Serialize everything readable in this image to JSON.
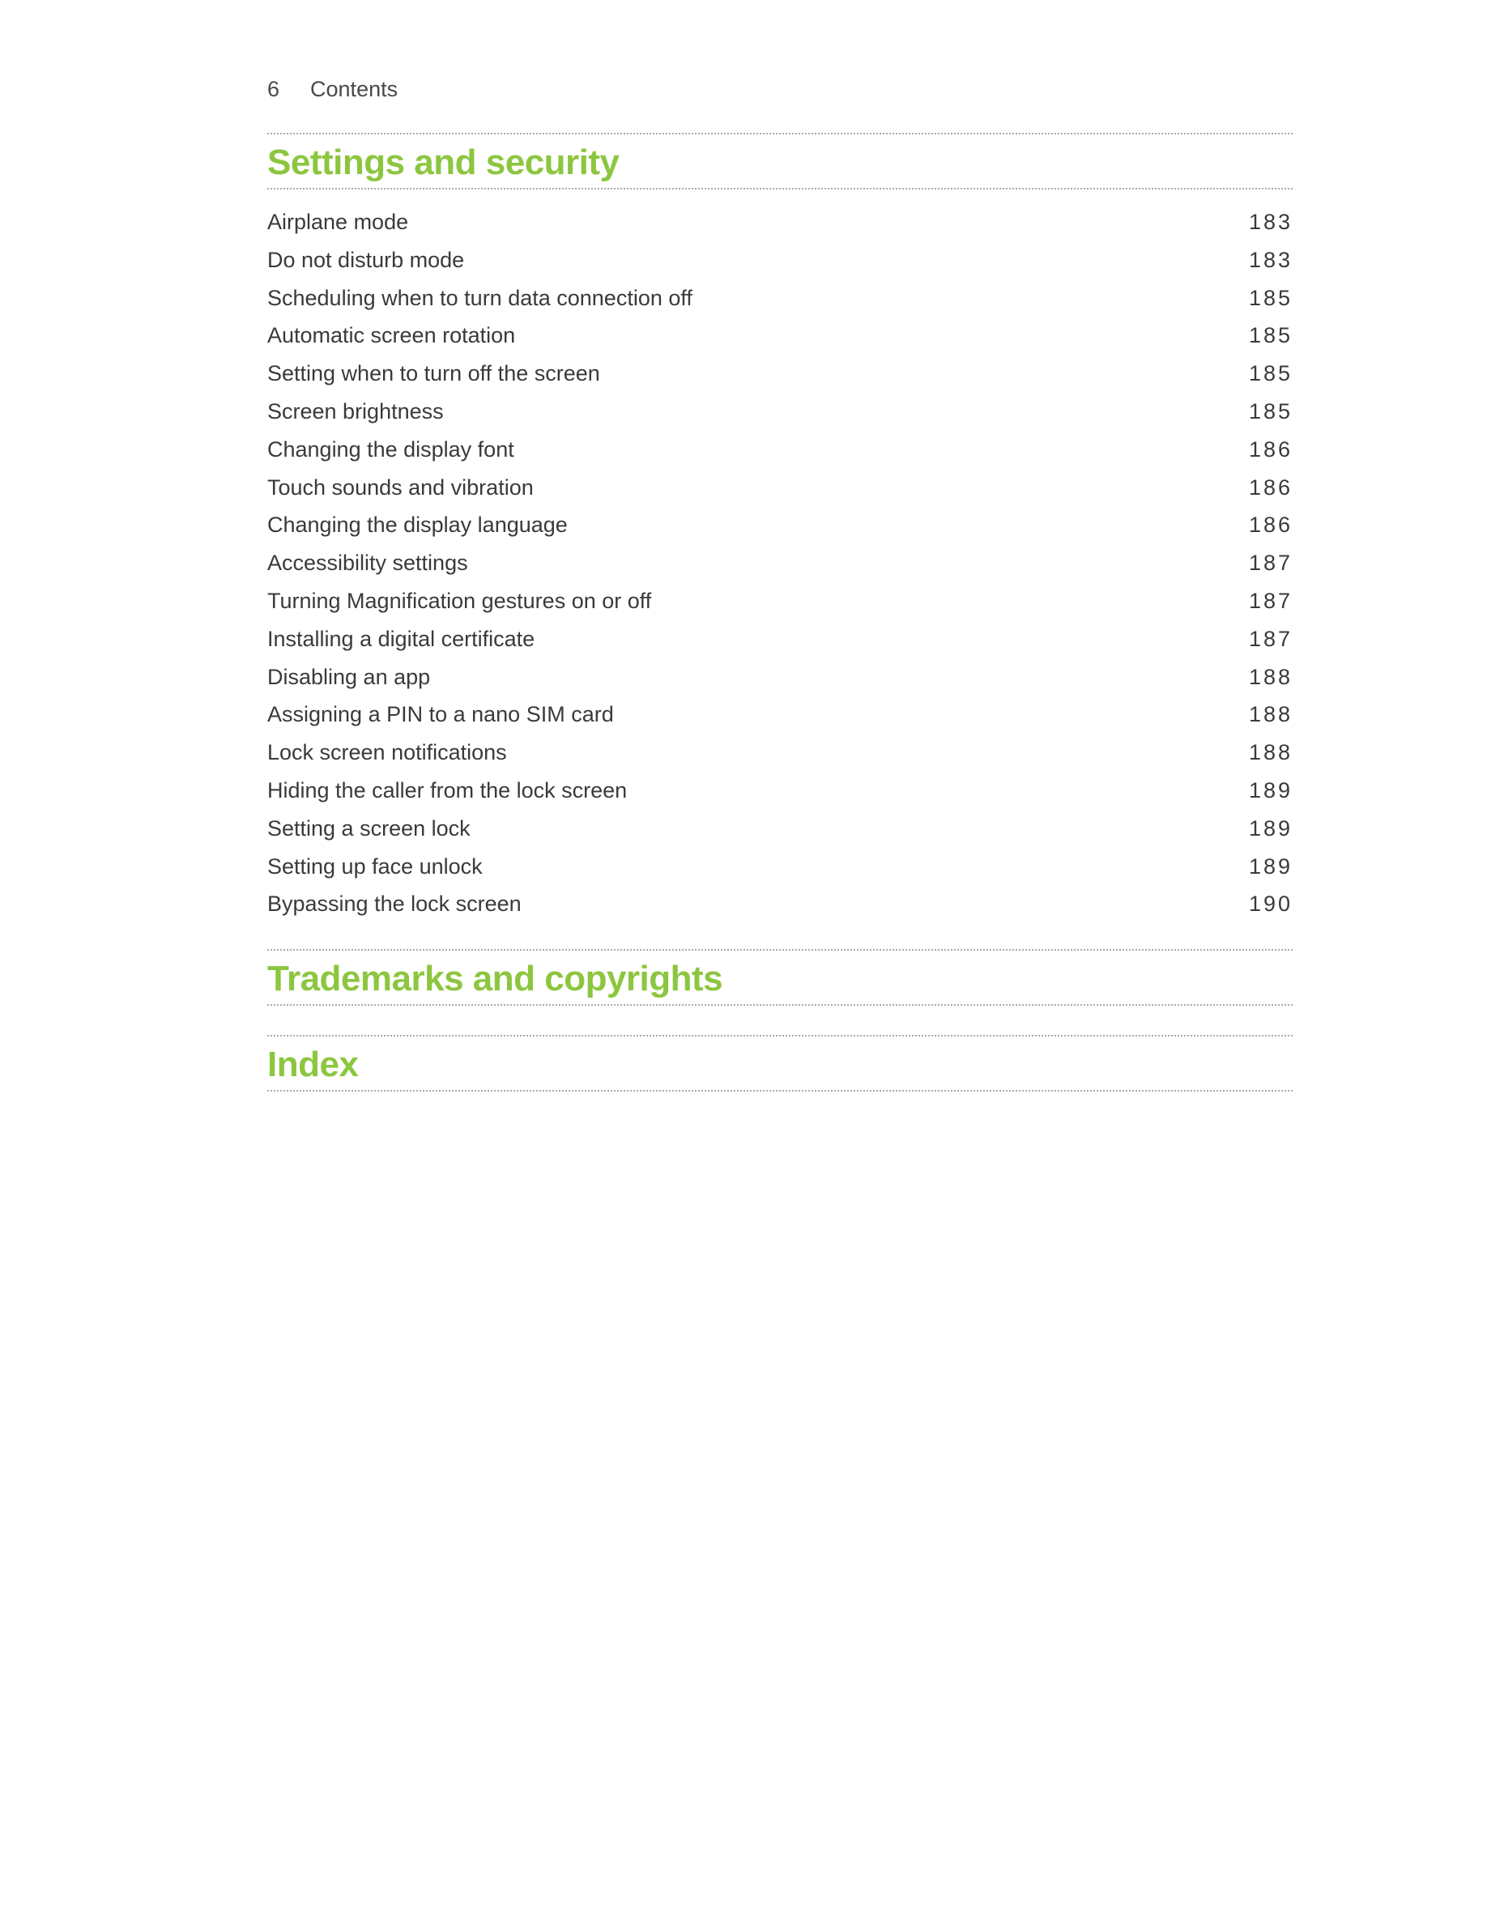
{
  "header": {
    "page_number": "6",
    "title": "Contents"
  },
  "sections": [
    {
      "heading": "Settings and security",
      "entries": [
        {
          "label": "Airplane mode",
          "page": "183"
        },
        {
          "label": "Do not disturb mode",
          "page": "183"
        },
        {
          "label": "Scheduling when to turn data connection off",
          "page": "185"
        },
        {
          "label": "Automatic screen rotation",
          "page": "185"
        },
        {
          "label": "Setting when to turn off the screen",
          "page": "185"
        },
        {
          "label": "Screen brightness",
          "page": "185"
        },
        {
          "label": "Changing the display font",
          "page": "186"
        },
        {
          "label": "Touch sounds and vibration",
          "page": "186"
        },
        {
          "label": "Changing the display language",
          "page": "186"
        },
        {
          "label": "Accessibility settings",
          "page": "187"
        },
        {
          "label": "Turning Magnification gestures on or off",
          "page": "187"
        },
        {
          "label": "Installing a digital certificate",
          "page": "187"
        },
        {
          "label": "Disabling an app",
          "page": "188"
        },
        {
          "label": "Assigning a PIN to a nano SIM card",
          "page": "188"
        },
        {
          "label": "Lock screen notifications",
          "page": "188"
        },
        {
          "label": "Hiding the caller from the lock screen",
          "page": "189"
        },
        {
          "label": "Setting a screen lock",
          "page": "189"
        },
        {
          "label": "Setting up face unlock",
          "page": "189"
        },
        {
          "label": "Bypassing the lock screen",
          "page": "190"
        }
      ]
    },
    {
      "heading": "Trademarks and copyrights",
      "entries": []
    },
    {
      "heading": "Index",
      "entries": []
    }
  ]
}
